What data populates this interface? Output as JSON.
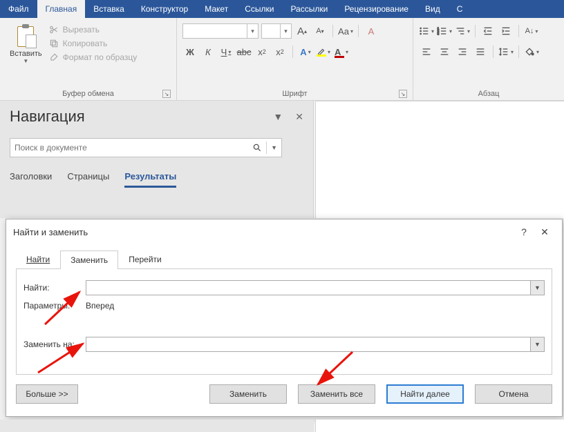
{
  "menu": {
    "file": "Файл",
    "home": "Главная",
    "insert": "Вставка",
    "design": "Конструктор",
    "layout": "Макет",
    "references": "Ссылки",
    "mail": "Рассылки",
    "review": "Рецензирование",
    "view": "Вид",
    "extra": "С"
  },
  "ribbon": {
    "clipboard": {
      "paste": "Вставить",
      "cut": "Вырезать",
      "copy": "Копировать",
      "format_painter": "Формат по образцу",
      "group_label": "Буфер обмена"
    },
    "font": {
      "group_label": "Шрифт",
      "bold": "Ж",
      "italic": "К",
      "underline": "Ч",
      "strike": "abc",
      "sub": "x",
      "sup": "x",
      "grow": "A",
      "shrink": "A",
      "case": "Aa",
      "clear": "A",
      "fontcolor": "A"
    },
    "paragraph": {
      "group_label": "Абзац"
    }
  },
  "nav": {
    "title": "Навигация",
    "search_placeholder": "Поиск в документе",
    "tabs": {
      "headings": "Заголовки",
      "pages": "Страницы",
      "results": "Результаты"
    }
  },
  "dialog": {
    "title": "Найти и заменить",
    "help": "?",
    "tabs": {
      "find": "Найти",
      "replace": "Заменить",
      "goto": "Перейти"
    },
    "find_label": "Найти:",
    "params_label": "Параметры:",
    "params_value": "Вперед",
    "replace_label": "Заменить на:",
    "more": "Больше >>",
    "replace_btn": "Заменить",
    "replace_all": "Заменить все",
    "find_next": "Найти далее",
    "cancel": "Отмена"
  }
}
